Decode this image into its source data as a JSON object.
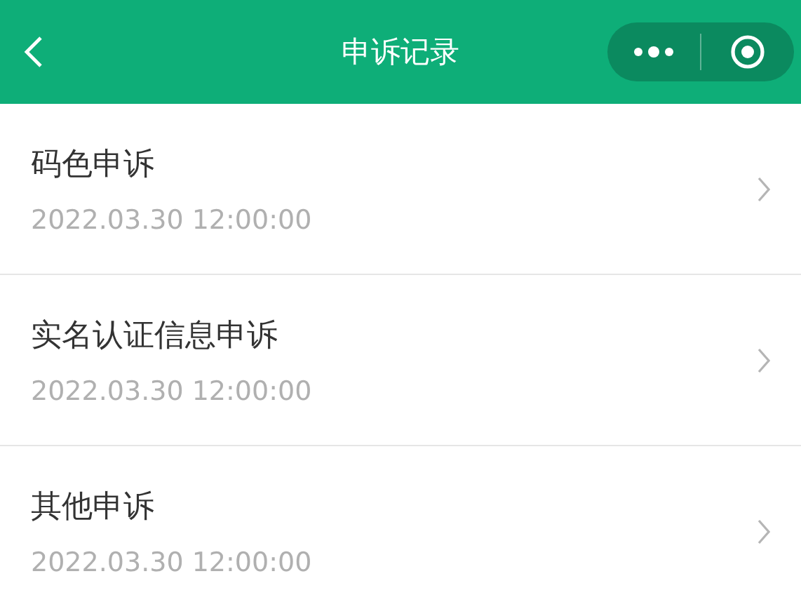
{
  "header": {
    "title": "申诉记录"
  },
  "records": [
    {
      "title": "码色申诉",
      "time": "2022.03.30 12:00:00"
    },
    {
      "title": "实名认证信息申诉",
      "time": "2022.03.30 12:00:00"
    },
    {
      "title": "其他申诉",
      "time": "2022.03.30 12:00:00"
    }
  ]
}
